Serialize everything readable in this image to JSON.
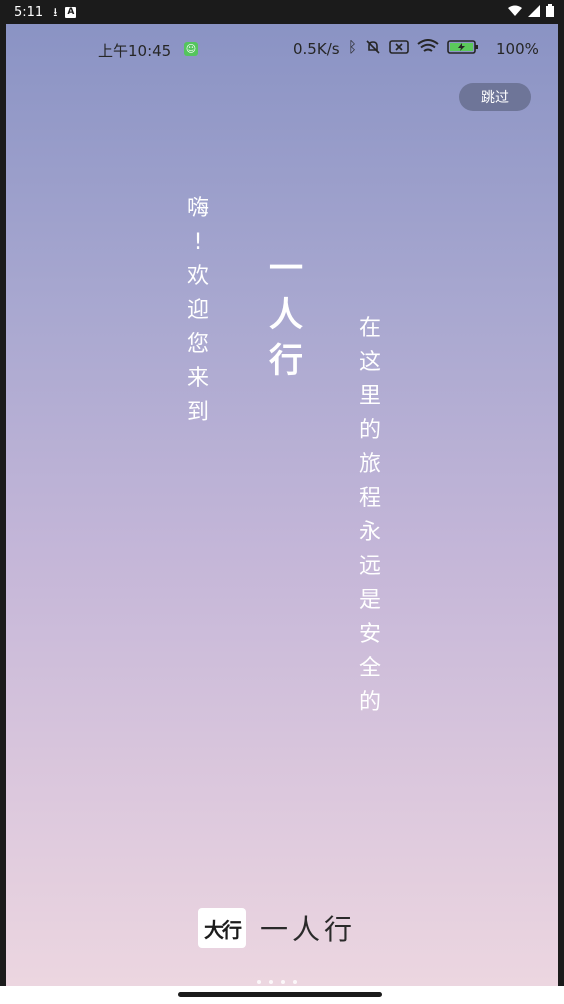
{
  "system_bar": {
    "time": "5:11"
  },
  "inner_status": {
    "time": "上午10:45",
    "speed": "0.5K/s",
    "battery": "100%"
  },
  "skip": "跳过",
  "greeting_chars": [
    "嗨",
    "!",
    "欢",
    "迎",
    "您",
    "来",
    "到"
  ],
  "title_chars": [
    "一",
    "人",
    "行"
  ],
  "slogan_chars": [
    "在",
    "这",
    "里",
    "的",
    "旅",
    "程",
    "永",
    "远",
    "是",
    "安",
    "全",
    "的"
  ],
  "brand": {
    "logo": "大行",
    "name": "一人行"
  },
  "pager": {
    "count": 4,
    "active": 0
  },
  "colors": {
    "skip_bg": "#6e7598",
    "gradient_top": "#8a93c4",
    "gradient_bottom": "#ecd6e0"
  }
}
